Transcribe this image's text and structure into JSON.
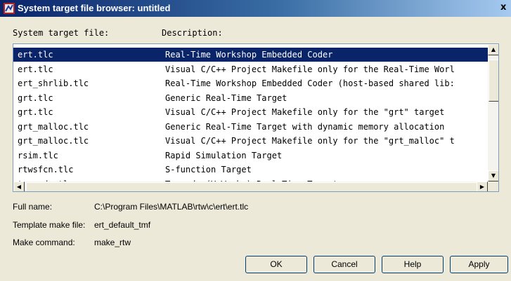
{
  "window": {
    "title": "System target file browser: untitled",
    "close_glyph": "x"
  },
  "headers": {
    "file": "System target file:",
    "description": "Description:"
  },
  "rows": [
    {
      "file": "ert.tlc",
      "description": "Real-Time Workshop Embedded Coder",
      "selected": true
    },
    {
      "file": "ert.tlc",
      "description": "Visual C/C++ Project Makefile only for the Real-Time Worl",
      "selected": false
    },
    {
      "file": "ert_shrlib.tlc",
      "description": "Real-Time Workshop Embedded Coder (host-based shared lib:",
      "selected": false
    },
    {
      "file": "grt.tlc",
      "description": "Generic Real-Time Target",
      "selected": false
    },
    {
      "file": "grt.tlc",
      "description": "Visual C/C++ Project Makefile only for the \"grt\" target",
      "selected": false
    },
    {
      "file": "grt_malloc.tlc",
      "description": "Generic Real-Time Target with dynamic memory allocation",
      "selected": false
    },
    {
      "file": "grt_malloc.tlc",
      "description": "Visual C/C++ Project Makefile only for the \"grt_malloc\" t",
      "selected": false
    },
    {
      "file": "rsim.tlc",
      "description": "Rapid Simulation Target",
      "selected": false
    },
    {
      "file": "rtwsfcn.tlc",
      "description": "S-function Target",
      "selected": false
    },
    {
      "file": "tornado.tlc",
      "description": "Tornado (VxWorks) Real-Time Target",
      "selected": false
    }
  ],
  "details": {
    "full_name_label": "Full name:",
    "full_name_value": "C:\\Program Files\\MATLAB\\rtw\\c\\ert\\ert.tlc",
    "template_label": "Template make file:",
    "template_value": "ert_default_tmf",
    "make_label": "Make command:",
    "make_value": "make_rtw"
  },
  "buttons": {
    "ok": "OK",
    "cancel": "Cancel",
    "help": "Help",
    "apply": "Apply"
  },
  "colors": {
    "selection": "#0a246a",
    "dialog_bg": "#ece9d8"
  }
}
